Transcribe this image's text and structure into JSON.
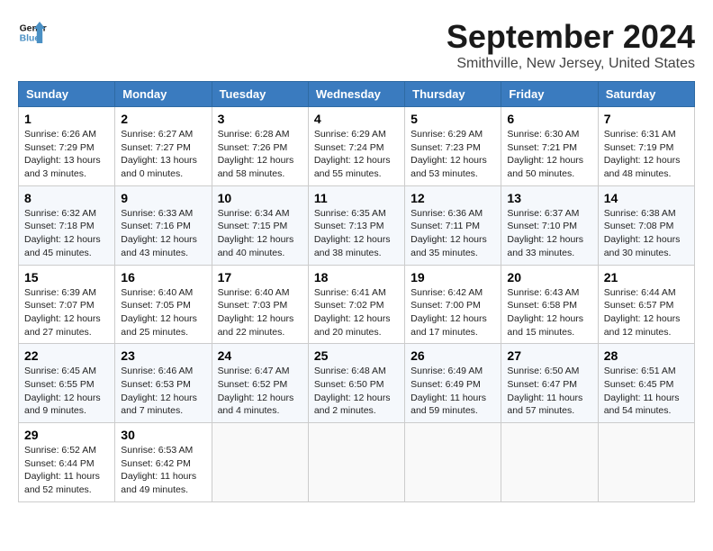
{
  "logo": {
    "line1": "General",
    "line2": "Blue"
  },
  "title": "September 2024",
  "subtitle": "Smithville, New Jersey, United States",
  "days_of_week": [
    "Sunday",
    "Monday",
    "Tuesday",
    "Wednesday",
    "Thursday",
    "Friday",
    "Saturday"
  ],
  "weeks": [
    [
      {
        "day": "1",
        "lines": [
          "Sunrise: 6:26 AM",
          "Sunset: 7:29 PM",
          "Daylight: 13 hours",
          "and 3 minutes."
        ]
      },
      {
        "day": "2",
        "lines": [
          "Sunrise: 6:27 AM",
          "Sunset: 7:27 PM",
          "Daylight: 13 hours",
          "and 0 minutes."
        ]
      },
      {
        "day": "3",
        "lines": [
          "Sunrise: 6:28 AM",
          "Sunset: 7:26 PM",
          "Daylight: 12 hours",
          "and 58 minutes."
        ]
      },
      {
        "day": "4",
        "lines": [
          "Sunrise: 6:29 AM",
          "Sunset: 7:24 PM",
          "Daylight: 12 hours",
          "and 55 minutes."
        ]
      },
      {
        "day": "5",
        "lines": [
          "Sunrise: 6:29 AM",
          "Sunset: 7:23 PM",
          "Daylight: 12 hours",
          "and 53 minutes."
        ]
      },
      {
        "day": "6",
        "lines": [
          "Sunrise: 6:30 AM",
          "Sunset: 7:21 PM",
          "Daylight: 12 hours",
          "and 50 minutes."
        ]
      },
      {
        "day": "7",
        "lines": [
          "Sunrise: 6:31 AM",
          "Sunset: 7:19 PM",
          "Daylight: 12 hours",
          "and 48 minutes."
        ]
      }
    ],
    [
      {
        "day": "8",
        "lines": [
          "Sunrise: 6:32 AM",
          "Sunset: 7:18 PM",
          "Daylight: 12 hours",
          "and 45 minutes."
        ]
      },
      {
        "day": "9",
        "lines": [
          "Sunrise: 6:33 AM",
          "Sunset: 7:16 PM",
          "Daylight: 12 hours",
          "and 43 minutes."
        ]
      },
      {
        "day": "10",
        "lines": [
          "Sunrise: 6:34 AM",
          "Sunset: 7:15 PM",
          "Daylight: 12 hours",
          "and 40 minutes."
        ]
      },
      {
        "day": "11",
        "lines": [
          "Sunrise: 6:35 AM",
          "Sunset: 7:13 PM",
          "Daylight: 12 hours",
          "and 38 minutes."
        ]
      },
      {
        "day": "12",
        "lines": [
          "Sunrise: 6:36 AM",
          "Sunset: 7:11 PM",
          "Daylight: 12 hours",
          "and 35 minutes."
        ]
      },
      {
        "day": "13",
        "lines": [
          "Sunrise: 6:37 AM",
          "Sunset: 7:10 PM",
          "Daylight: 12 hours",
          "and 33 minutes."
        ]
      },
      {
        "day": "14",
        "lines": [
          "Sunrise: 6:38 AM",
          "Sunset: 7:08 PM",
          "Daylight: 12 hours",
          "and 30 minutes."
        ]
      }
    ],
    [
      {
        "day": "15",
        "lines": [
          "Sunrise: 6:39 AM",
          "Sunset: 7:07 PM",
          "Daylight: 12 hours",
          "and 27 minutes."
        ]
      },
      {
        "day": "16",
        "lines": [
          "Sunrise: 6:40 AM",
          "Sunset: 7:05 PM",
          "Daylight: 12 hours",
          "and 25 minutes."
        ]
      },
      {
        "day": "17",
        "lines": [
          "Sunrise: 6:40 AM",
          "Sunset: 7:03 PM",
          "Daylight: 12 hours",
          "and 22 minutes."
        ]
      },
      {
        "day": "18",
        "lines": [
          "Sunrise: 6:41 AM",
          "Sunset: 7:02 PM",
          "Daylight: 12 hours",
          "and 20 minutes."
        ]
      },
      {
        "day": "19",
        "lines": [
          "Sunrise: 6:42 AM",
          "Sunset: 7:00 PM",
          "Daylight: 12 hours",
          "and 17 minutes."
        ]
      },
      {
        "day": "20",
        "lines": [
          "Sunrise: 6:43 AM",
          "Sunset: 6:58 PM",
          "Daylight: 12 hours",
          "and 15 minutes."
        ]
      },
      {
        "day": "21",
        "lines": [
          "Sunrise: 6:44 AM",
          "Sunset: 6:57 PM",
          "Daylight: 12 hours",
          "and 12 minutes."
        ]
      }
    ],
    [
      {
        "day": "22",
        "lines": [
          "Sunrise: 6:45 AM",
          "Sunset: 6:55 PM",
          "Daylight: 12 hours",
          "and 9 minutes."
        ]
      },
      {
        "day": "23",
        "lines": [
          "Sunrise: 6:46 AM",
          "Sunset: 6:53 PM",
          "Daylight: 12 hours",
          "and 7 minutes."
        ]
      },
      {
        "day": "24",
        "lines": [
          "Sunrise: 6:47 AM",
          "Sunset: 6:52 PM",
          "Daylight: 12 hours",
          "and 4 minutes."
        ]
      },
      {
        "day": "25",
        "lines": [
          "Sunrise: 6:48 AM",
          "Sunset: 6:50 PM",
          "Daylight: 12 hours",
          "and 2 minutes."
        ]
      },
      {
        "day": "26",
        "lines": [
          "Sunrise: 6:49 AM",
          "Sunset: 6:49 PM",
          "Daylight: 11 hours",
          "and 59 minutes."
        ]
      },
      {
        "day": "27",
        "lines": [
          "Sunrise: 6:50 AM",
          "Sunset: 6:47 PM",
          "Daylight: 11 hours",
          "and 57 minutes."
        ]
      },
      {
        "day": "28",
        "lines": [
          "Sunrise: 6:51 AM",
          "Sunset: 6:45 PM",
          "Daylight: 11 hours",
          "and 54 minutes."
        ]
      }
    ],
    [
      {
        "day": "29",
        "lines": [
          "Sunrise: 6:52 AM",
          "Sunset: 6:44 PM",
          "Daylight: 11 hours",
          "and 52 minutes."
        ]
      },
      {
        "day": "30",
        "lines": [
          "Sunrise: 6:53 AM",
          "Sunset: 6:42 PM",
          "Daylight: 11 hours",
          "and 49 minutes."
        ]
      },
      {
        "day": "",
        "lines": []
      },
      {
        "day": "",
        "lines": []
      },
      {
        "day": "",
        "lines": []
      },
      {
        "day": "",
        "lines": []
      },
      {
        "day": "",
        "lines": []
      }
    ]
  ]
}
